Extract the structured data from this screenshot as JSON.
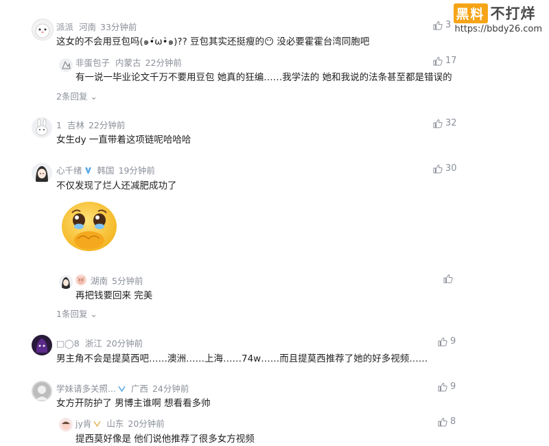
{
  "watermark": {
    "brand_box": "黑料",
    "brand_text": "不打烊",
    "url": "https://bbdy26.com"
  },
  "comments": [
    {
      "user": "派派",
      "location": "河南",
      "time": "33分钟前",
      "text": "这女的不会用豆包吗(๑•́ω•̀๑)?? 豆包其实还挺瘦的😶 没必要霍霍台湾同胞吧",
      "likes": "3",
      "reply": {
        "user": "非蛋包子",
        "location": "内蒙古",
        "time": "22分钟前",
        "text": "有一说一毕业论文千万不要用豆包 她真的狂编……我学法的 她和我说的法条甚至都是错误的",
        "likes": "17"
      },
      "replies_label": "2条回复"
    },
    {
      "user": "1",
      "location": "吉林",
      "time": "22分钟前",
      "text": "女生dy 一直带着这项链呢哈哈哈",
      "likes": "32"
    },
    {
      "user": "心千绪",
      "location": "韩国",
      "time": "19分钟前",
      "text": "不仅发现了烂人还减肥成功了",
      "likes": "30",
      "emoji": "😭",
      "reply": {
        "user": "",
        "location": "湖南",
        "time": "5分钟前",
        "text": "再把钱要回来 完美",
        "likes": ""
      },
      "replies_label": "1条回复"
    },
    {
      "user": "□◯8",
      "location": "浙江",
      "time": "20分钟前",
      "text": "男主角不会是提莫西吧……澳洲……上海……74w……而且提莫西推荐了她的好多视频……",
      "likes": "9"
    },
    {
      "user": "学妹请多关照...",
      "location": "广西",
      "time": "24分钟前",
      "text": "女方开防护了 男博主谁啊 想看看多帅",
      "likes": "9",
      "reply": {
        "user": "jy肯",
        "location": "山东",
        "time": "20分钟前",
        "text": "提西莫好像是   他们说他推荐了很多女方视频",
        "likes": "8"
      }
    }
  ]
}
